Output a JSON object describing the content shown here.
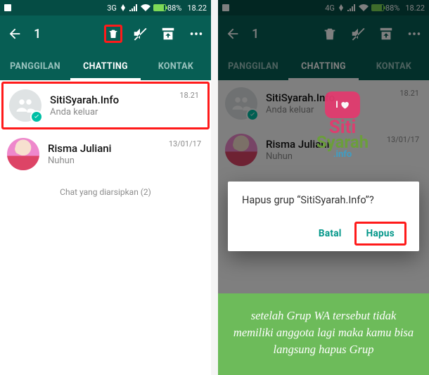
{
  "status": {
    "battery_pct": "88%",
    "time": "18.22",
    "net_label": "3G"
  },
  "status2": {
    "net_label": "4G"
  },
  "header": {
    "selected_count": "1"
  },
  "tabs": {
    "calls": "PANGGILAN",
    "chats": "CHATTING",
    "contacts": "KONTAK"
  },
  "chats": [
    {
      "title": "SitiSyarah.Info",
      "subtitle": "Anda keluar",
      "time": "18.21"
    },
    {
      "title": "Risma Juliani",
      "subtitle": "Nuhun",
      "time": "13/01/17"
    }
  ],
  "archived": "Chat yang diarsipkan (2)",
  "dialog": {
    "message": "Hapus grup “SitiSyarah.Info”?",
    "cancel": "Batal",
    "confirm": "Hapus"
  },
  "watermark": {
    "love": "I",
    "line1": "Siti",
    "line2": "Syarah",
    "line3": ".info"
  },
  "caption": "setelah Grup WA tersebut tidak memiliki anggota lagi maka kamu bisa langsung hapus Grup"
}
